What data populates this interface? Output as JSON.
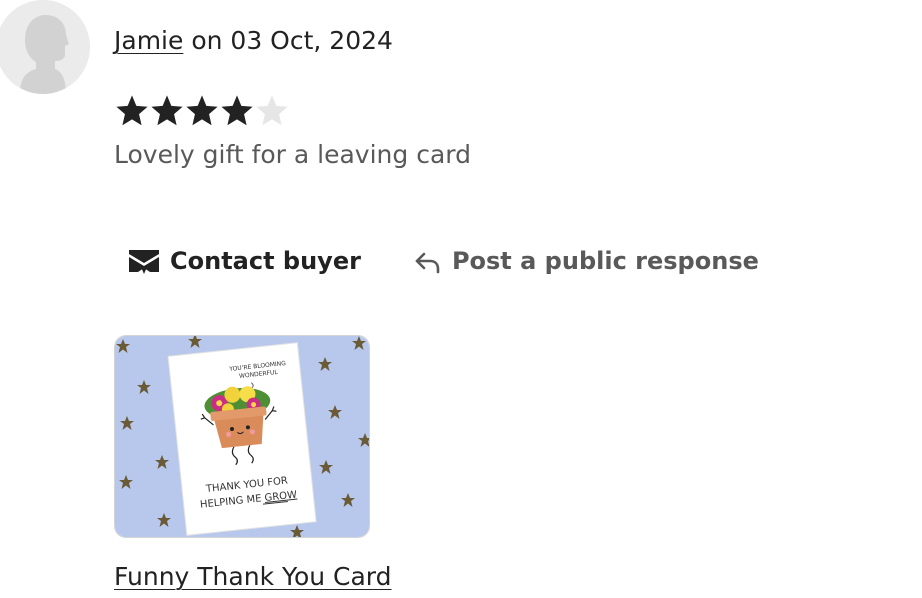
{
  "review": {
    "reviewer_name": "Jamie",
    "date_text": " on 03 Oct, 2024",
    "rating": 4,
    "rating_max": 5,
    "star_filled_color": "#222222",
    "star_empty_color": "#e6e6e6",
    "text": "Lovely gift for a leaving card"
  },
  "actions": {
    "contact_label": "Contact buyer",
    "contact_icon": "envelope-icon",
    "respond_label": "Post a public response",
    "respond_icon": "reply-arrow-icon"
  },
  "product": {
    "title": "Funny Thank You Card",
    "image": {
      "background_color": "#b7c8ec",
      "card_caption_top_line1": "YOU'RE BLOOMING",
      "card_caption_top_line2": "WONDERFUL",
      "card_caption_bottom_line1": "THANK YOU FOR",
      "card_caption_bottom_line2_prefix": "HELPING ME ",
      "card_caption_bottom_line2_emph": "GROW"
    }
  }
}
